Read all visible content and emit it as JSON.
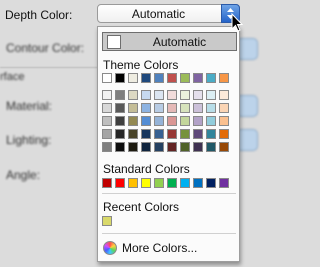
{
  "form": {
    "depth_color_label": "Depth Color:",
    "contour_color_label": "Contour Color:",
    "surface_label": "rface",
    "material_label": "Material:",
    "lighting_label": "Lighting:",
    "angle_label": "Angle:"
  },
  "depth_select": {
    "value": "Automatic"
  },
  "color_popup": {
    "automatic_label": "Automatic",
    "theme_title": "Theme Colors",
    "theme_row": [
      "#ffffff",
      "#000000",
      "#eeece1",
      "#1f497d",
      "#4f81bd",
      "#c0504d",
      "#9bbb59",
      "#8064a2",
      "#4bacc6",
      "#f79646"
    ],
    "theme_shades": [
      [
        "#f2f2f2",
        "#d8d8d8",
        "#bfbfbf",
        "#a5a5a5",
        "#7f7f7f"
      ],
      [
        "#7f7f7f",
        "#595959",
        "#3f3f3f",
        "#262626",
        "#0c0c0c"
      ],
      [
        "#ddd9c3",
        "#c4bd97",
        "#938953",
        "#494429",
        "#1d1b10"
      ],
      [
        "#c6d9f0",
        "#8db3e2",
        "#548dd4",
        "#17365d",
        "#0f243e"
      ],
      [
        "#dbe5f1",
        "#b8cce4",
        "#95b3d7",
        "#366092",
        "#244061"
      ],
      [
        "#f2dcdb",
        "#e5b9b7",
        "#d99694",
        "#953734",
        "#632423"
      ],
      [
        "#ebf1dd",
        "#d7e3bc",
        "#c3d69b",
        "#76923c",
        "#4f6128"
      ],
      [
        "#e5e0ec",
        "#ccc1d9",
        "#b2a2c7",
        "#5f497a",
        "#3f3151"
      ],
      [
        "#dbeef3",
        "#b7dde8",
        "#92cddc",
        "#31859b",
        "#205867"
      ],
      [
        "#fdeada",
        "#fbd5b5",
        "#fac08f",
        "#e36c09",
        "#974806"
      ]
    ],
    "standard_title": "Standard Colors",
    "standard_row": [
      "#c00000",
      "#ff0000",
      "#ffc000",
      "#ffff00",
      "#92d050",
      "#00b050",
      "#00b0f0",
      "#0070c0",
      "#002060",
      "#7030a0"
    ],
    "recent_title": "Recent Colors",
    "recent_row": [
      "#d9d96a"
    ],
    "more_colors_label": "More Colors..."
  }
}
